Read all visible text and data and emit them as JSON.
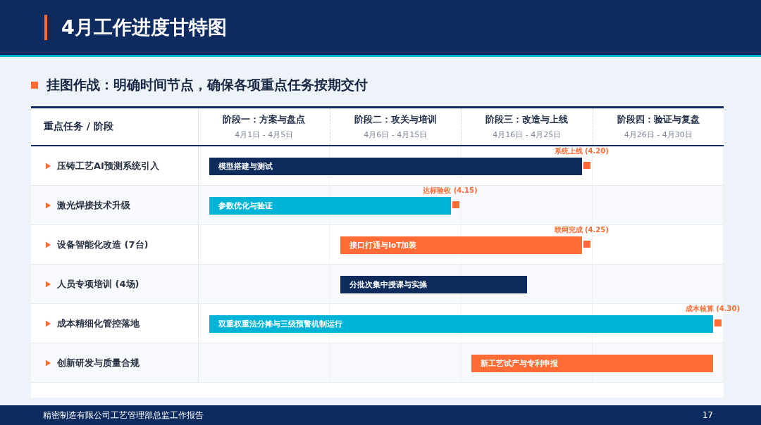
{
  "title": "4月工作进度甘特图",
  "subtitle": "挂图作战：明确时间节点，确保各项重点任务按期交付",
  "table": {
    "corner": "重点任务 / 阶段",
    "phases": [
      {
        "name": "阶段一：方案与盘点",
        "dates": "4月1日 - 4月5日"
      },
      {
        "name": "阶段二：攻关与培训",
        "dates": "4月6日 - 4月15日"
      },
      {
        "name": "阶段三：改造与上线",
        "dates": "4月16日 - 4月25日"
      },
      {
        "name": "阶段四：验证与复盘",
        "dates": "4月26日 - 4月30日"
      }
    ],
    "rows": [
      {
        "task": "压铸工艺AI预测系统引入",
        "bar": "模型搭建与测试",
        "color": "#0f2b5b",
        "milestone": "系统上线 (4.20)"
      },
      {
        "task": "激光焊接技术升级",
        "bar": "参数优化与验证",
        "color": "#00b4d8",
        "milestone": "达标验收 (4.15)"
      },
      {
        "task": "设备智能化改造 (7台)",
        "bar": "接口打通与IoT加装",
        "color": "#ff6b35",
        "milestone": "联网完成 (4.25)"
      },
      {
        "task": "人员专项培训 (4场)",
        "bar": "分批次集中授课与实操",
        "color": "#0f2b5b"
      },
      {
        "task": "成本精细化管控落地",
        "bar": "双重权重法分摊与三级预警机制运行",
        "color": "#00b4d8",
        "milestone": "成本核算 (4.30)"
      },
      {
        "task": "创新研发与质量合规",
        "bar": "新工艺试产与专利申报",
        "color": "#ff6b35"
      }
    ]
  },
  "footer": {
    "text": "精密制造有限公司工艺管理部总监工作报告",
    "page": "17"
  }
}
